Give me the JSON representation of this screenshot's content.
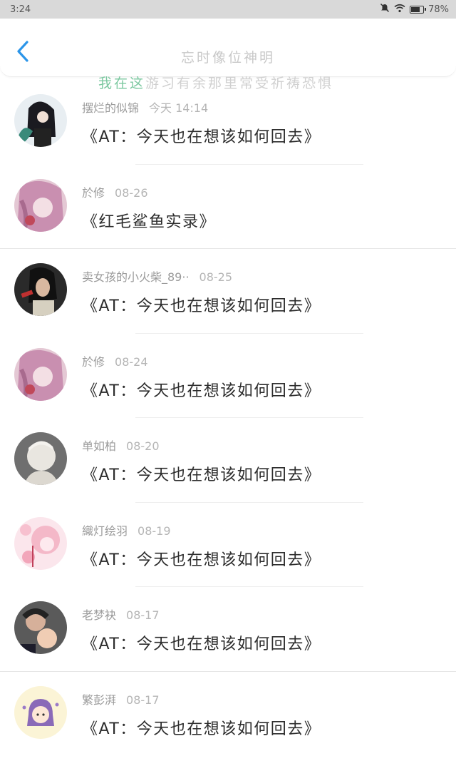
{
  "status": {
    "time": "3:24",
    "battery": "78%",
    "battery_level": 0.78
  },
  "header": {
    "back_icon": "chevron-left-icon",
    "accent": "#2b95e9",
    "overlay_line1": "忘时像位神明",
    "overlay_line2_green": "我在这",
    "overlay_line2_rest": "游习有余那里常受祈祷恐惧"
  },
  "items": [
    {
      "name": "摆烂的似锦",
      "date": "今天 14:14",
      "title": "《AT：今天也在想该如何回去》",
      "avatar": "dark-hair-girl-with-dragon"
    },
    {
      "name": "於修",
      "date": "08-26",
      "title": "《红毛鲨鱼实录》",
      "avatar": "pink-hair-anime"
    },
    {
      "name": "卖女孩的小火柴_89··",
      "date": "08-25",
      "title": "《AT：今天也在想该如何回去》",
      "avatar": "dark-photo-girl"
    },
    {
      "name": "於修",
      "date": "08-24",
      "title": "《AT：今天也在想该如何回去》",
      "avatar": "pink-hair-anime"
    },
    {
      "name": "单如柏",
      "date": "08-20",
      "title": "《AT：今天也在想该如何回去》",
      "avatar": "sketch-boy"
    },
    {
      "name": "織灯绘羽",
      "date": "08-19",
      "title": "《AT：今天也在想该如何回去》",
      "avatar": "pink-flower-girl"
    },
    {
      "name": "老梦袂",
      "date": "08-17",
      "title": "《AT：今天也在想该如何回去》",
      "avatar": "mother-and-child-photo"
    },
    {
      "name": "繁彭湃",
      "date": "08-17",
      "title": "《AT：今天也在想该如何回去》",
      "avatar": "cartoon-purple-girl"
    }
  ]
}
